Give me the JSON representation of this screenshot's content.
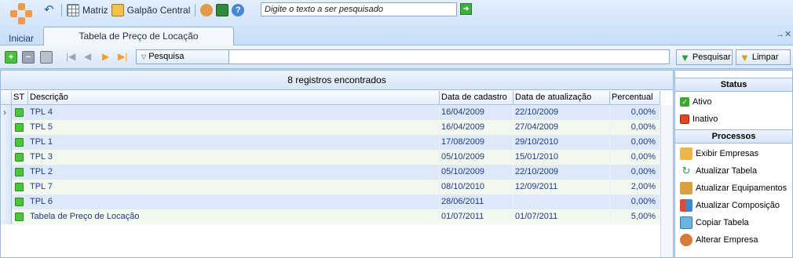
{
  "app": {
    "start_label": "Iniciar"
  },
  "quick_access": {
    "matriz": "Matriz",
    "galpao": "Galpão Central"
  },
  "search": {
    "placeholder": "Digite o texto a ser pesquisado",
    "go_icon": "arrow-right-icon"
  },
  "tab": {
    "title": "Tabela de Preço de Locação"
  },
  "filter": {
    "label": "Pesquisa",
    "value": ""
  },
  "buttons": {
    "search": "Pesquisar",
    "clear": "Limpar"
  },
  "grid": {
    "title": "8 registros encontrados",
    "columns": [
      "ST",
      "Descrição",
      "Data de cadastro",
      "Data de atualização",
      "Percentual"
    ],
    "rows": [
      {
        "desc": "TPL 4",
        "created": "16/04/2009",
        "updated": "22/10/2009",
        "percent": "0,00%"
      },
      {
        "desc": "TPL 5",
        "created": "16/04/2009",
        "updated": "27/04/2009",
        "percent": "0,00%"
      },
      {
        "desc": "TPL 1",
        "created": "17/08/2009",
        "updated": "29/10/2010",
        "percent": "0,00%"
      },
      {
        "desc": "TPL 3",
        "created": "05/10/2009",
        "updated": "15/01/2010",
        "percent": "0,00%"
      },
      {
        "desc": "TPL 2",
        "created": "05/10/2009",
        "updated": "22/10/2009",
        "percent": "0,00%"
      },
      {
        "desc": "TPL 7",
        "created": "08/10/2010",
        "updated": "12/09/2011",
        "percent": "2,00%"
      },
      {
        "desc": "TPL 6",
        "created": "28/06/2011",
        "updated": "",
        "percent": "0,00%"
      },
      {
        "desc": "Tabela de Preço de Locação",
        "created": "01/07/2011",
        "updated": "01/07/2011",
        "percent": "5,00%"
      }
    ]
  },
  "side": {
    "status_title": "Status",
    "status_items": [
      {
        "label": "Ativo",
        "color": "#3aa82e"
      },
      {
        "label": "Inativo",
        "color": "#e0481c"
      }
    ],
    "process_title": "Processos",
    "process_items": [
      {
        "label": "Exibir Empresas"
      },
      {
        "label": "Atualizar Tabela"
      },
      {
        "label": "Atualizar Equipamentos"
      },
      {
        "label": "Atualizar Composição"
      },
      {
        "label": "Copiar Tabela"
      },
      {
        "label": "Alterar Empresa"
      }
    ]
  },
  "colors": {
    "accent": "#1f3a8a",
    "active": "#4cc43e",
    "row_even": "#dde9f8",
    "row_odd": "#f2f8ee"
  }
}
